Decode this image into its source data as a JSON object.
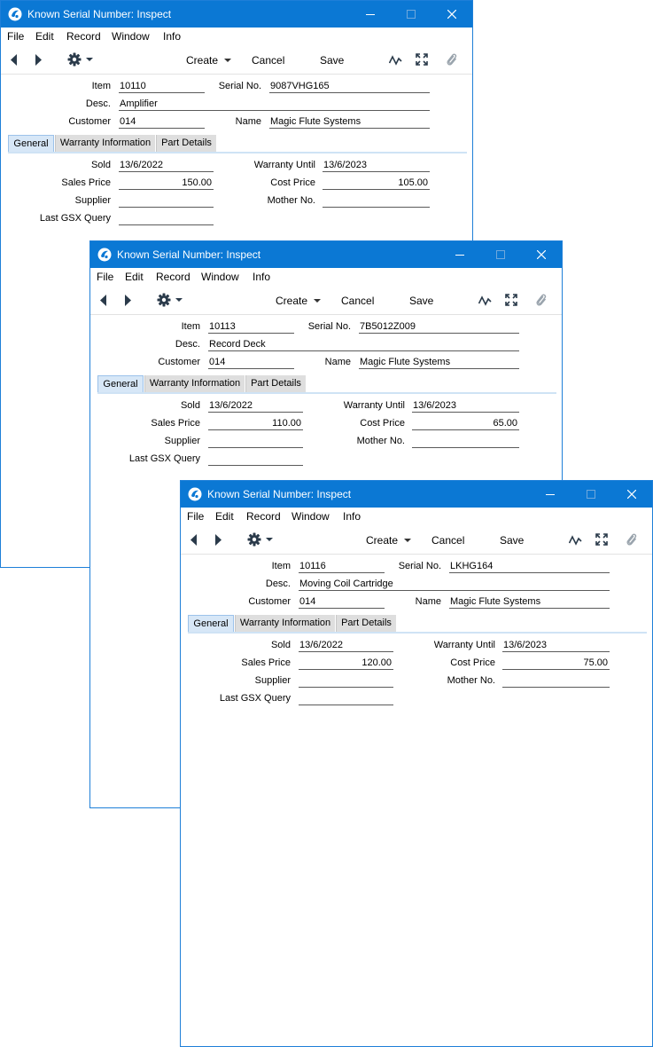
{
  "app": {
    "window_title": "Known Serial Number: Inspect",
    "menu": [
      "File",
      "Edit",
      "Record",
      "Window",
      "Info"
    ],
    "toolbar": {
      "create": "Create",
      "cancel": "Cancel",
      "save": "Save"
    },
    "tabs": [
      "General",
      "Warranty Information",
      "Part Details"
    ],
    "labels": {
      "item": "Item",
      "serial_no": "Serial No.",
      "desc": "Desc.",
      "customer": "Customer",
      "name": "Name",
      "sold": "Sold",
      "warranty_until": "Warranty Until",
      "sales_price": "Sales Price",
      "cost_price": "Cost Price",
      "supplier": "Supplier",
      "mother_no": "Mother No.",
      "last_gsx_query": "Last GSX Query"
    },
    "colors": {
      "titlebar": "#0b78d4",
      "active_tab": "#d7e7f7",
      "inactive_tab": "#dedede"
    },
    "icons": [
      "app-icon",
      "prev-record-icon",
      "next-record-icon",
      "gear-icon",
      "activity-icon",
      "expand-icon",
      "attachment-icon",
      "minimize-icon",
      "maximize-icon",
      "close-icon"
    ]
  },
  "records": [
    {
      "item": "10110",
      "serial_no": "9087VHG165",
      "desc": "Amplifier",
      "customer": "014",
      "name": "Magic Flute Systems",
      "sold": "13/6/2022",
      "warranty_until": "13/6/2023",
      "sales_price": "150.00",
      "cost_price": "105.00",
      "supplier": "",
      "mother_no": "",
      "last_gsx_query": ""
    },
    {
      "item": "10113",
      "serial_no": "7B5012Z009",
      "desc": "Record Deck",
      "customer": "014",
      "name": "Magic Flute Systems",
      "sold": "13/6/2022",
      "warranty_until": "13/6/2023",
      "sales_price": "110.00",
      "cost_price": "65.00",
      "supplier": "",
      "mother_no": "",
      "last_gsx_query": ""
    },
    {
      "item": "10116",
      "serial_no": "LKHG164",
      "desc": "Moving Coil Cartridge",
      "customer": "014",
      "name": "Magic Flute Systems",
      "sold": "13/6/2022",
      "warranty_until": "13/6/2023",
      "sales_price": "120.00",
      "cost_price": "75.00",
      "supplier": "",
      "mother_no": "",
      "last_gsx_query": ""
    }
  ]
}
